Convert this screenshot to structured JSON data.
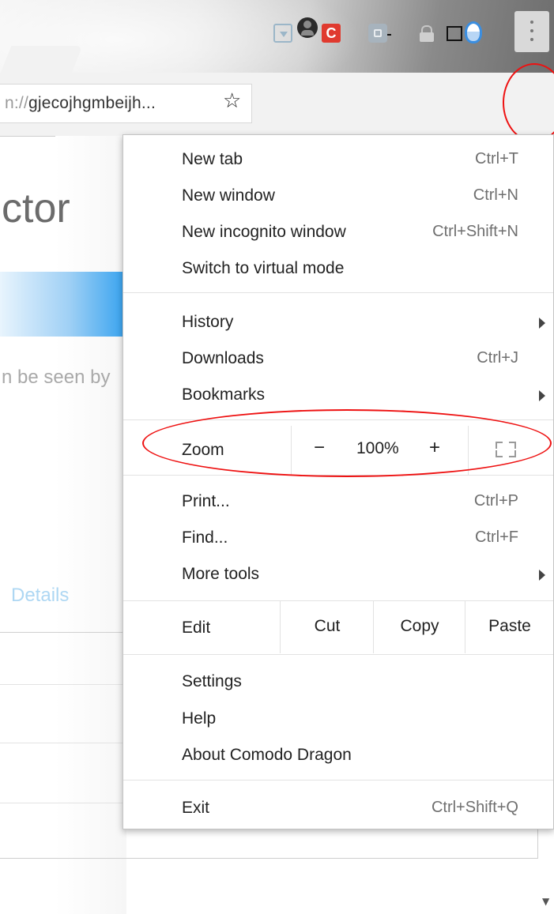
{
  "window": {
    "controls": {
      "minimize": "minimize-icon",
      "maximize": "maximize-icon",
      "close": "✕"
    },
    "profile_icon": "profile-icon"
  },
  "toolbar": {
    "url_scheme_fragment": "n://",
    "url_host": "gjecojhgmbeijh...",
    "bookmark_icon": "☆",
    "extensions": [
      "download-icon",
      "comodo-icon",
      "puzzle-icon",
      "lock-icon",
      "shield-icon"
    ],
    "menu_icon": "vertical-dots-icon"
  },
  "background_page": {
    "title_fragment": "ctor",
    "text_fragment": "n be seen by",
    "link_fragment": "Details"
  },
  "menu": {
    "groups": [
      [
        {
          "label": "New tab",
          "shortcut": "Ctrl+T"
        },
        {
          "label": "New window",
          "shortcut": "Ctrl+N"
        },
        {
          "label": "New incognito window",
          "shortcut": "Ctrl+Shift+N"
        },
        {
          "label": "Switch to virtual mode",
          "shortcut": ""
        }
      ],
      [
        {
          "label": "History",
          "shortcut": "",
          "submenu": true
        },
        {
          "label": "Downloads",
          "shortcut": "Ctrl+J"
        },
        {
          "label": "Bookmarks",
          "shortcut": "",
          "submenu": true
        }
      ],
      [
        {
          "label": "Print...",
          "shortcut": "Ctrl+P"
        },
        {
          "label": "Find...",
          "shortcut": "Ctrl+F"
        },
        {
          "label": "More tools",
          "shortcut": "",
          "submenu": true
        }
      ],
      [
        {
          "label": "Settings",
          "shortcut": ""
        },
        {
          "label": "Help",
          "shortcut": ""
        },
        {
          "label": "About Comodo Dragon",
          "shortcut": ""
        }
      ],
      [
        {
          "label": "Exit",
          "shortcut": "Ctrl+Shift+Q"
        }
      ]
    ],
    "zoom": {
      "label": "Zoom",
      "minus": "−",
      "value": "100%",
      "plus": "+",
      "fullscreen_icon": "fullscreen-icon"
    },
    "edit": {
      "label": "Edit",
      "cut": "Cut",
      "copy": "Copy",
      "paste": "Paste"
    }
  },
  "annotations": {
    "highlight_color": "#ee1111"
  }
}
